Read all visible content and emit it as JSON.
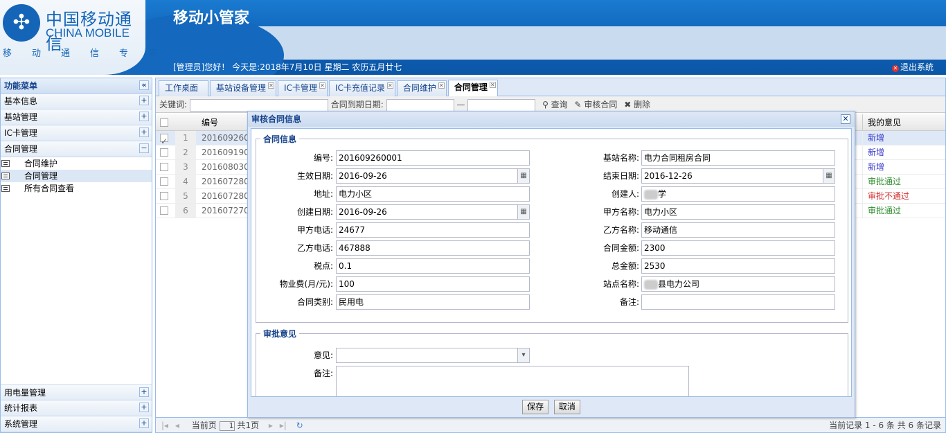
{
  "header": {
    "logo_cn": "中国移动通信",
    "logo_en": "CHINA MOBILE",
    "slogan": "移动通信专家",
    "app_title": "移动小管家",
    "welcome": "[管理员]您好！ 今天是:2018年7月10日 星期二 农历五月廿七",
    "logout": "退出系统"
  },
  "sidebar": {
    "title": "功能菜单",
    "groups": [
      {
        "label": "基本信息"
      },
      {
        "label": "基站管理"
      },
      {
        "label": "IC卡管理"
      },
      {
        "label": "合同管理",
        "items": [
          "合同维护",
          "合同管理",
          "所有合同查看"
        ]
      }
    ],
    "bottom_groups": [
      {
        "label": "用电量管理"
      },
      {
        "label": "统计报表"
      },
      {
        "label": "系统管理"
      }
    ]
  },
  "tabs": [
    "工作桌面",
    "基站设备管理",
    "IC卡管理",
    "IC卡充值记录",
    "合同维护",
    "合同管理"
  ],
  "toolbar": {
    "keyword_label": "关键词:",
    "expire_label": "合同到期日期:",
    "dash": "—",
    "query": "查询",
    "review": "审核合同",
    "delete": "删除"
  },
  "grid": {
    "headers": {
      "code": "编号",
      "opinion": "我的意见"
    },
    "rows": [
      {
        "num": "1",
        "code": "201609260",
        "opinion": "新增",
        "color": "#3a3acc"
      },
      {
        "num": "2",
        "code": "201609190",
        "opinion": "新增",
        "color": "#3a3acc"
      },
      {
        "num": "3",
        "code": "201608030",
        "opinion": "新增",
        "color": "#3a3acc"
      },
      {
        "num": "4",
        "code": "201607280",
        "opinion": "审批通过",
        "color": "#2c8c2c"
      },
      {
        "num": "5",
        "code": "201607280",
        "opinion": "审批不通过",
        "color": "#d43030"
      },
      {
        "num": "6",
        "code": "201607270",
        "opinion": "审批通过",
        "color": "#2c8c2c"
      }
    ]
  },
  "pager": {
    "current_label": "当前页",
    "page": "1",
    "total": "共1页",
    "summary": "当前记录 1 - 6 条 共 6 条记录"
  },
  "dialog": {
    "title": "审核合同信息",
    "section1": "合同信息",
    "section2": "审批意见",
    "fields": {
      "code_label": "编号:",
      "code": "201609260001",
      "station_label": "基站名称:",
      "station": "电力合同租房合同",
      "start_label": "生效日期:",
      "start": "2016-09-26",
      "end_label": "结束日期:",
      "end": "2016-12-26",
      "address_label": "地址:",
      "address": "电力小区",
      "creator_label": "创建人:",
      "creator": "学",
      "create_date_label": "创建日期:",
      "create_date": "2016-09-26",
      "party_a_label": "甲方名称:",
      "party_a": "电力小区",
      "phone_a_label": "甲方电话:",
      "phone_a": "24677",
      "party_b_label": "乙方名称:",
      "party_b": "移动通信",
      "phone_b_label": "乙方电话:",
      "phone_b": "467888",
      "amount_label": "合同金额:",
      "amount": "2300",
      "tax_label": "税点:",
      "tax": "0.1",
      "total_label": "总金额:",
      "total": "2530",
      "fee_label": "物业费(月/元):",
      "fee": "100",
      "site_label": "站点名称:",
      "site": "县电力公司",
      "type_label": "合同类别:",
      "type": "民用电",
      "remark_label": "备注:",
      "remark": ""
    },
    "approval": {
      "opinion_label": "意见:",
      "opinion": "",
      "remark_label": "备注:"
    },
    "save": "保存",
    "cancel": "取消"
  }
}
